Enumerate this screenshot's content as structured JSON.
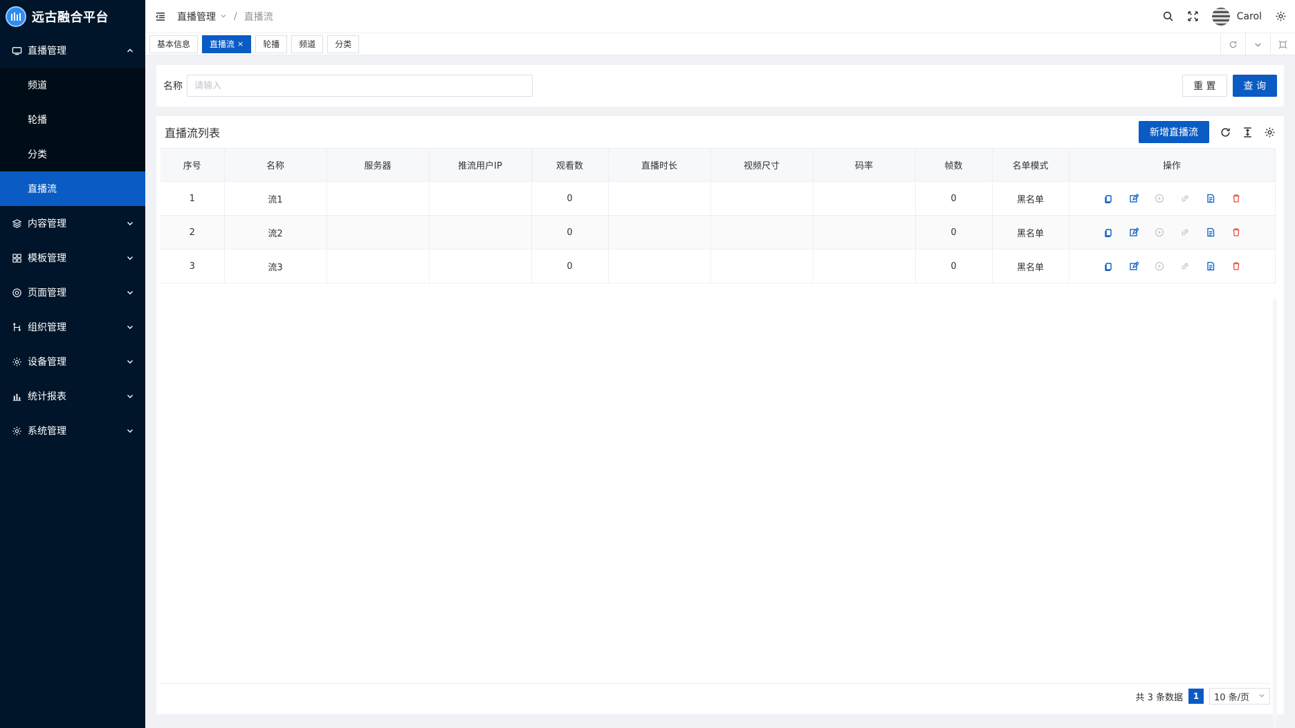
{
  "app": {
    "title": "远古融合平台"
  },
  "sidebar": {
    "items": [
      {
        "label": "直播管理",
        "icon": "monitor-icon",
        "expanded": true,
        "children": [
          {
            "label": "频道"
          },
          {
            "label": "轮播"
          },
          {
            "label": "分类"
          },
          {
            "label": "直播流",
            "active": true
          }
        ]
      },
      {
        "label": "内容管理",
        "icon": "layers-icon"
      },
      {
        "label": "模板管理",
        "icon": "grid-icon"
      },
      {
        "label": "页面管理",
        "icon": "palette-icon"
      },
      {
        "label": "组织管理",
        "icon": "org-icon"
      },
      {
        "label": "设备管理",
        "icon": "gear-icon"
      },
      {
        "label": "统计报表",
        "icon": "bar-chart-icon"
      },
      {
        "label": "系统管理",
        "icon": "gear-icon"
      }
    ]
  },
  "header": {
    "breadcrumb": {
      "parent": "直播管理",
      "current": "直播流",
      "separator": "/"
    },
    "username": "Carol"
  },
  "tabs": [
    {
      "label": "基本信息"
    },
    {
      "label": "直播流",
      "active": true,
      "close": "×"
    },
    {
      "label": "轮播"
    },
    {
      "label": "频道"
    },
    {
      "label": "分类"
    }
  ],
  "search": {
    "label": "名称",
    "placeholder": "请输入",
    "value": "",
    "reset_label": "重 置",
    "query_label": "查 询"
  },
  "table": {
    "title": "直播流列表",
    "add_label": "新增直播流",
    "columns": [
      "序号",
      "名称",
      "服务器",
      "推流用户IP",
      "观看数",
      "直播时长",
      "视频尺寸",
      "码率",
      "帧数",
      "名单模式",
      "操作"
    ],
    "rows": [
      {
        "index": "1",
        "name": "流1",
        "server": "",
        "ip": "",
        "viewers": "0",
        "duration": "",
        "size": "",
        "bitrate": "",
        "frames": "0",
        "mode": "黑名单"
      },
      {
        "index": "2",
        "name": "流2",
        "server": "",
        "ip": "",
        "viewers": "0",
        "duration": "",
        "size": "",
        "bitrate": "",
        "frames": "0",
        "mode": "黑名单"
      },
      {
        "index": "3",
        "name": "流3",
        "server": "",
        "ip": "",
        "viewers": "0",
        "duration": "",
        "size": "",
        "bitrate": "",
        "frames": "0",
        "mode": "黑名单"
      }
    ],
    "row_actions": [
      "copy-icon",
      "edit-icon",
      "play-icon",
      "link-icon",
      "document-icon",
      "delete-icon"
    ]
  },
  "pagination": {
    "total_text": "共 3 条数据",
    "current_page": "1",
    "page_size": "10 条/页"
  },
  "colors": {
    "sidebar_bg": "#001529",
    "submenu_bg": "#000c17",
    "primary": "#0a5bc4",
    "danger": "#e74c3c",
    "disabled_icon": "#c0c4cc"
  }
}
